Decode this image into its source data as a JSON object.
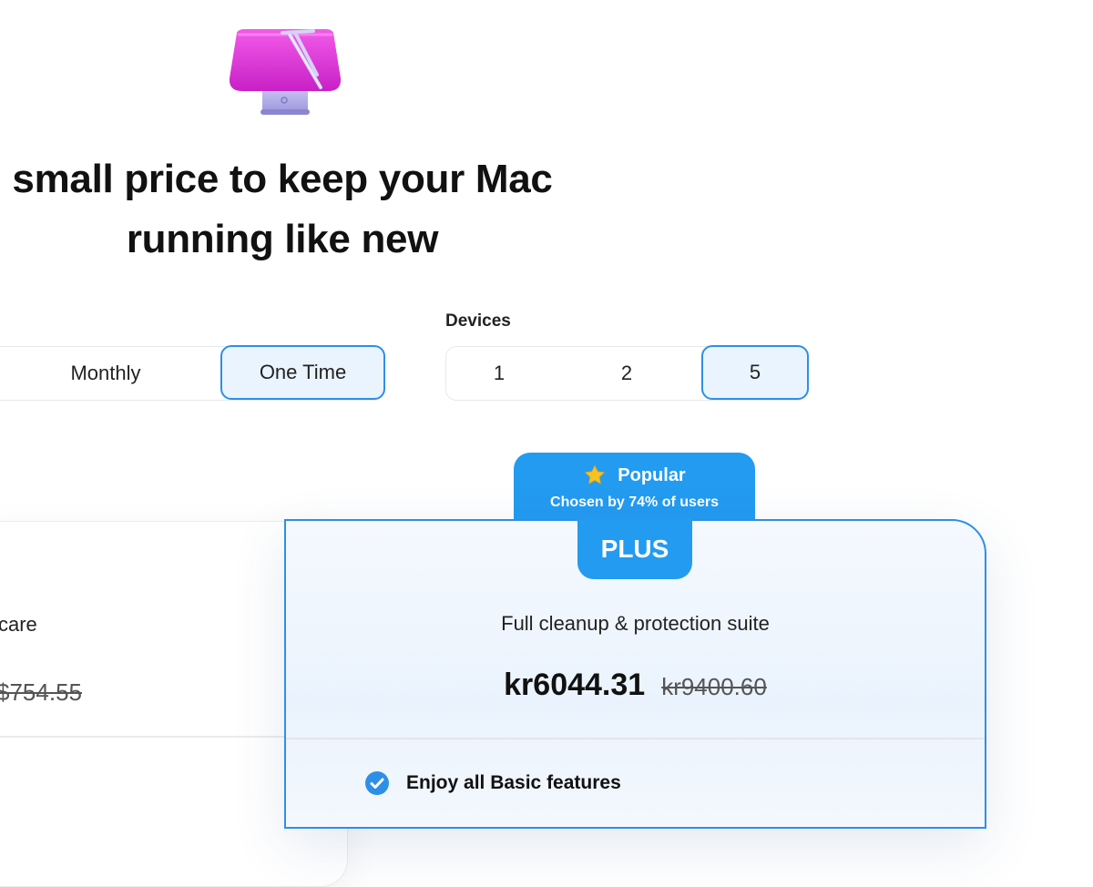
{
  "headline": {
    "line1": "small price to keep your Mac",
    "line2": "running like new"
  },
  "billing": {
    "options": [
      "Monthly",
      "One Time"
    ],
    "selected": "One Time"
  },
  "devices": {
    "label": "Devices",
    "options": [
      "1",
      "2",
      "5"
    ],
    "selected": "5"
  },
  "popular": {
    "title": "Popular",
    "subtitle": "Chosen by 74% of users",
    "icon": "star-icon"
  },
  "basic_plan": {
    "description": "care",
    "old_price": "$754.55"
  },
  "plus_plan": {
    "name": "PLUS",
    "description": "Full cleanup & protection suite",
    "price": "kr6044.31",
    "old_price": "kr9400.60",
    "features": [
      "Enjoy all Basic features"
    ]
  },
  "colors": {
    "accent": "#239bf0",
    "selected_border": "#2e8fe6",
    "selected_bg": "#eaf4fe",
    "app_icon": "#e23fd6"
  }
}
